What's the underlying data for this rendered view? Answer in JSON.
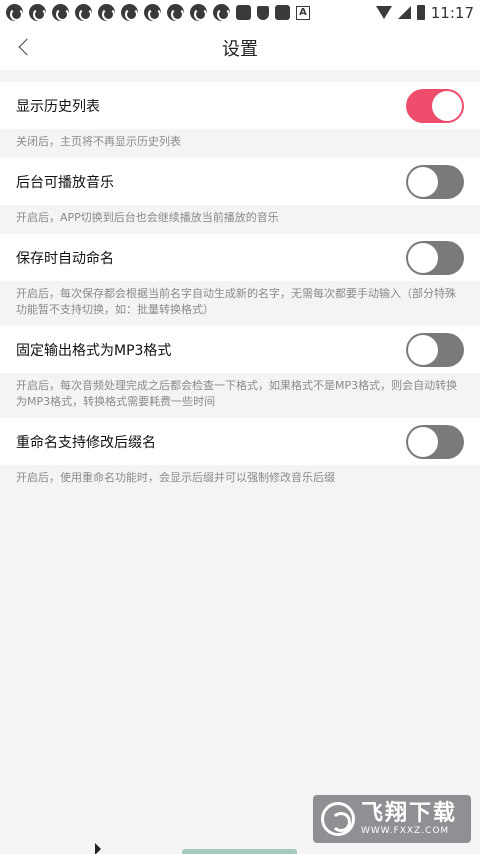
{
  "status_bar": {
    "time": "11:17",
    "icons": [
      "app-notification-icon",
      "square-notification-icon",
      "shield-icon",
      "a-icon",
      "wifi-icon",
      "signal-icon",
      "battery-icon"
    ]
  },
  "header": {
    "title": "设置"
  },
  "settings": [
    {
      "label": "显示历史列表",
      "desc": "关闭后，主页将不再显示历史列表",
      "on": true
    },
    {
      "label": "后台可播放音乐",
      "desc": "开启后，APP切换到后台也会继续播放当前播放的音乐",
      "on": false
    },
    {
      "label": "保存时自动命名",
      "desc": "开启后，每次保存都会根据当前名字自动生成新的名字，无需每次都要手动输入（部分特殊功能暂不支持切换，如：批量转换格式）",
      "on": false
    },
    {
      "label": "固定输出格式为MP3格式",
      "desc": "开启后，每次音频处理完成之后都会检查一下格式，如果格式不是MP3格式，则会自动转换为MP3格式，转换格式需要耗费一些时间",
      "on": false
    },
    {
      "label": "重命名支持修改后缀名",
      "desc": "开启后，使用重命名功能时，会显示后缀并可以强制修改音乐后缀",
      "on": false
    }
  ],
  "watermark": {
    "title": "飞翔下载",
    "url": "WWW.FXXZ.COM"
  },
  "colors": {
    "toggle_on": "#ee4d6c",
    "toggle_off": "#7a7a7a",
    "background": "#f4f4f4"
  }
}
